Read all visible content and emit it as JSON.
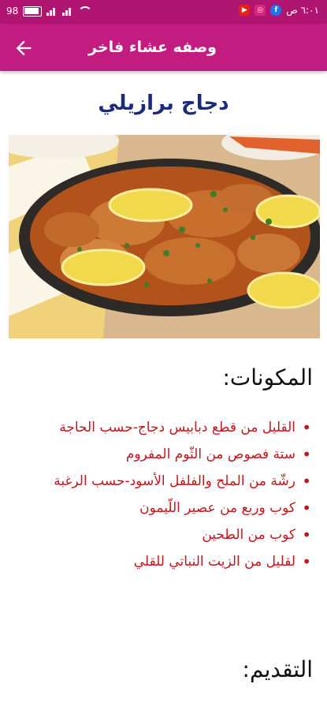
{
  "status_bar": {
    "battery": "98",
    "time": "٦:٠١ ص"
  },
  "app_bar": {
    "title": "وصفه عشاء فاخر"
  },
  "recipe": {
    "title": "دجاج برازيلي",
    "ingredients_heading": "المكونات:",
    "ingredients": [
      "القليل من قطع دبابيس دجاج-حسب الحاجة",
      "ستة فصوص من الثّوم المفروم",
      "رشّة من الملح والفلفل الأسود-حسب الرغبة",
      "كوب وربع من عصير اللّيمون",
      "كوب من الطحين",
      "لقليل من الزيت النباتي للقلي"
    ],
    "preparation_heading": "التقديم:"
  },
  "colors": {
    "status_bar": "#b01572",
    "app_bar": "#c31c80",
    "title": "#1b2a7c",
    "ingredient": "#c2181d"
  }
}
